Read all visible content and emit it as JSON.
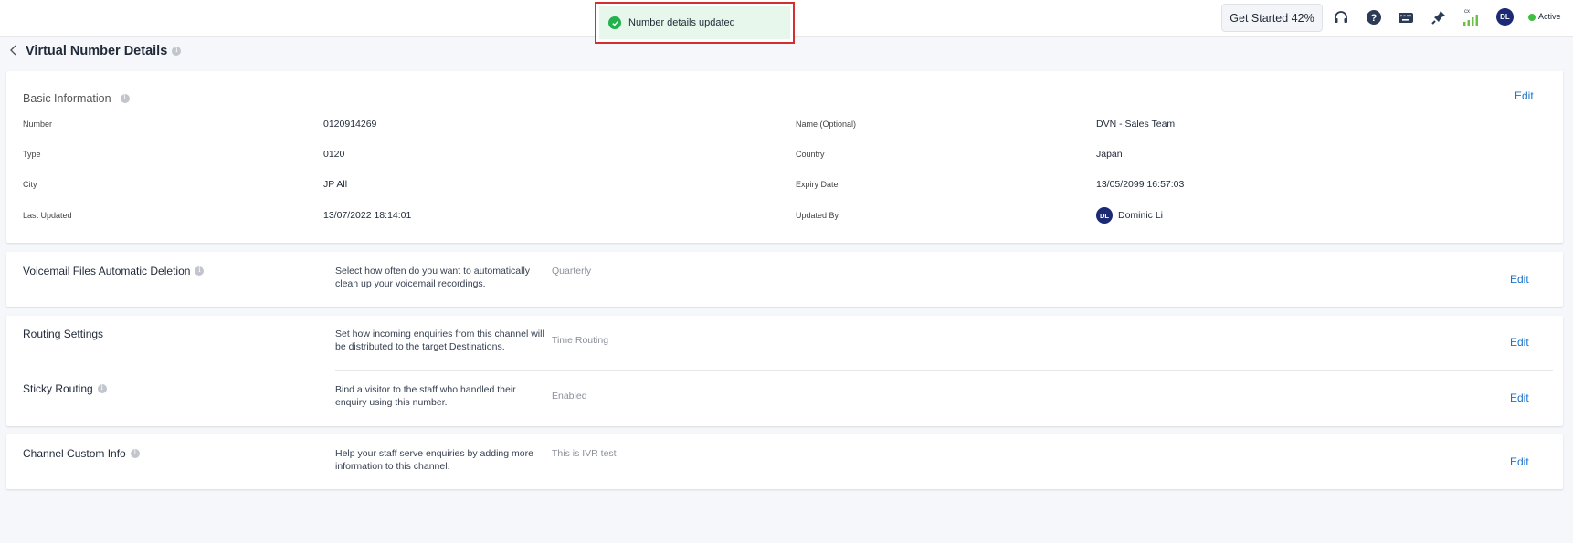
{
  "toast": {
    "message": "Number details updated"
  },
  "topbar": {
    "get_started_label": "Get Started 42%",
    "cx_label": "cx",
    "avatar_initials": "DL",
    "status_label": "Active",
    "icons": [
      "headset-icon",
      "help-icon",
      "keyboard-icon",
      "pin-icon",
      "signal-icon"
    ]
  },
  "page": {
    "title": "Virtual Number Details"
  },
  "basic": {
    "heading": "Basic Information",
    "edit_label": "Edit",
    "fields": {
      "number": {
        "label": "Number",
        "value": "0120914269"
      },
      "name": {
        "label": "Name (Optional)",
        "value": "DVN - Sales Team"
      },
      "type": {
        "label": "Type",
        "value": "0120"
      },
      "country": {
        "label": "Country",
        "value": "Japan"
      },
      "city": {
        "label": "City",
        "value": "JP All"
      },
      "expiry": {
        "label": "Expiry Date",
        "value": "13/05/2099 16:57:03"
      },
      "last_updated": {
        "label": "Last Updated",
        "value": "13/07/2022 18:14:01"
      },
      "updated_by": {
        "label": "Updated By",
        "value": "Dominic Li",
        "initials": "DL"
      }
    }
  },
  "sections": {
    "voicemail": {
      "title": "Voicemail Files Automatic Deletion",
      "desc": "Select how often do you want to automatically clean up your voicemail recordings.",
      "value": "Quarterly",
      "edit_label": "Edit"
    },
    "routing": {
      "title": "Routing Settings",
      "desc": "Set how incoming enquiries from this channel will be distributed to the target Destinations.",
      "value": "Time Routing",
      "edit_label": "Edit"
    },
    "sticky": {
      "title": "Sticky Routing",
      "desc": "Bind a visitor to the staff who handled their enquiry using this number.",
      "value": "Enabled",
      "edit_label": "Edit"
    },
    "custom_info": {
      "title": "Channel Custom Info",
      "desc": "Help your staff serve enquiries by adding more information to this channel.",
      "value": "This is IVR test",
      "edit_label": "Edit"
    }
  },
  "colors": {
    "accent": "#1a73c9",
    "toast_bg": "#e8f7ec",
    "toast_border": "#d32f2f",
    "avatar": "#1b2a72",
    "status": "#3fbf3f"
  }
}
